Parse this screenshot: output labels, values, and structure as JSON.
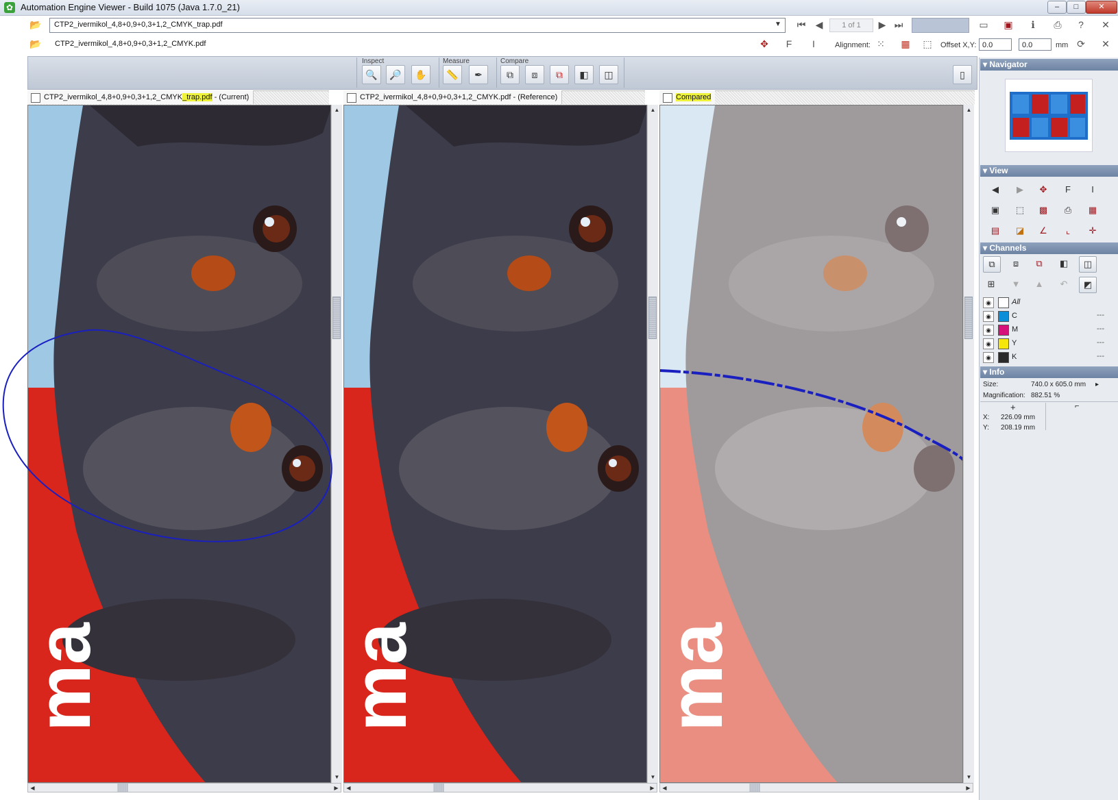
{
  "window": {
    "title": "Automation Engine Viewer - Build 1075 (Java 1.7.0_21)",
    "controls": {
      "minimize": "–",
      "maximize": "□",
      "close": "✕"
    }
  },
  "files": {
    "current": "CTP2_ivermikol_4,8+0,9+0,3+1,2_CMYK_trap.pdf",
    "reference": "CTP2_ivermikol_4,8+0,9+0,3+1,2_CMYK.pdf"
  },
  "paging": {
    "indicator": "1 of 1"
  },
  "alignment": {
    "label": "Alignment:",
    "offset_label": "Offset X,Y:",
    "x": "0.0",
    "y": "0.0",
    "unit": "mm"
  },
  "toolbar": {
    "groups": [
      {
        "label": "Inspect"
      },
      {
        "label": "Measure"
      },
      {
        "label": "Compare"
      }
    ]
  },
  "panels": {
    "current": {
      "tab_prefix": "CTP2_ivermikol_4,8+0,9+0,3+1,2_CMYK",
      "tab_highlight": "_trap.pdf",
      "tab_suffix": " - (Current)"
    },
    "reference": {
      "tab": "CTP2_ivermikol_4,8+0,9+0,3+1,2_CMYK.pdf - (Reference)"
    },
    "compared": {
      "tab": "Compared"
    },
    "artwork_text": "ma"
  },
  "sidebar": {
    "navigator": {
      "title": "Navigator"
    },
    "view": {
      "title": "View"
    },
    "channels": {
      "title": "Channels",
      "items": [
        {
          "name": "All",
          "color": "#ffffff",
          "value": ""
        },
        {
          "name": "C",
          "color": "#0a8fd8",
          "value": "---"
        },
        {
          "name": "M",
          "color": "#d6127a",
          "value": "---"
        },
        {
          "name": "Y",
          "color": "#f5e60c",
          "value": "---"
        },
        {
          "name": "K",
          "color": "#2a2a2a",
          "value": "---"
        }
      ]
    },
    "info": {
      "title": "Info",
      "size_label": "Size:",
      "size_value": "740.0 x 605.0 mm",
      "magnification_label": "Magnification:",
      "magnification_value": "882.51 %",
      "x_label": "X:",
      "x_value": "226.09 mm",
      "y_label": "Y:",
      "y_value": "208.19 mm"
    }
  },
  "colors": {
    "sky": "#9fc8e4",
    "red_bg": "#d8261c",
    "annotation_blue": "#1a1fc0",
    "highlight": "#eef23a"
  }
}
